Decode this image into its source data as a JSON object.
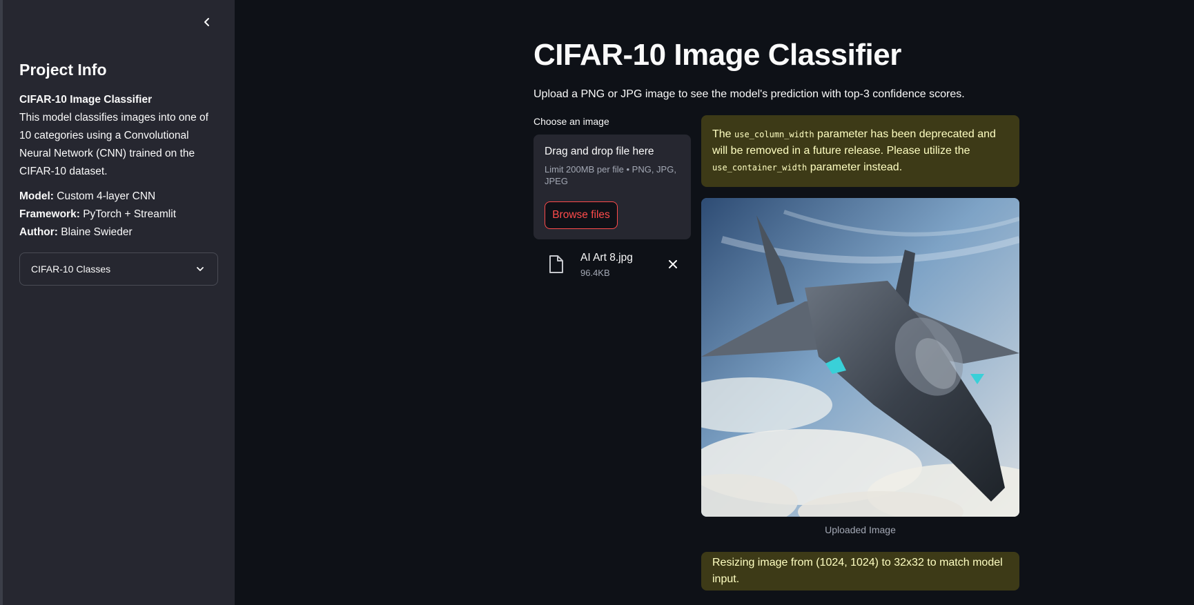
{
  "sidebar": {
    "title": "Project Info",
    "app_name": "CIFAR-10 Image Classifier",
    "description": "This model classifies images into one of 10 categories using a Convolutional Neural Network (CNN) trained on the CIFAR-10 dataset.",
    "model_label": "Model:",
    "model_value": "Custom 4-layer CNN",
    "framework_label": "Framework:",
    "framework_value": "PyTorch + Streamlit",
    "author_label": "Author:",
    "author_value": "Blaine Swieder",
    "expander_label": "CIFAR-10 Classes"
  },
  "main": {
    "title": "CIFAR-10 Image Classifier",
    "subtitle": "Upload a PNG or JPG image to see the model's prediction with top-3 confidence scores.",
    "uploader": {
      "label": "Choose an image",
      "drop_text": "Drag and drop file here",
      "limit_text": "Limit 200MB per file • PNG, JPG, JPEG",
      "browse_label": "Browse files"
    },
    "file": {
      "name": "AI Art 8.jpg",
      "size": "96.4KB"
    },
    "warning1": {
      "part1": "The ",
      "code1": "use_column_width",
      "part2": " parameter has been deprecated and will be removed in a future release. Please utilize the ",
      "code2": "use_container_width",
      "part3": " parameter instead."
    },
    "image_caption": "Uploaded Image",
    "warning2": "Resizing image from (1024, 1024) to 32x32 to match model input."
  },
  "colors": {
    "background": "#0e1117",
    "sidebar": "#262730",
    "accent": "#ff4b4b",
    "warning_bg": "#3d3a17",
    "warning_text": "#ffffc2"
  },
  "icons": {
    "collapse": "chevron-left-icon",
    "expander": "chevron-down-icon",
    "file": "file-icon",
    "remove": "close-icon"
  }
}
